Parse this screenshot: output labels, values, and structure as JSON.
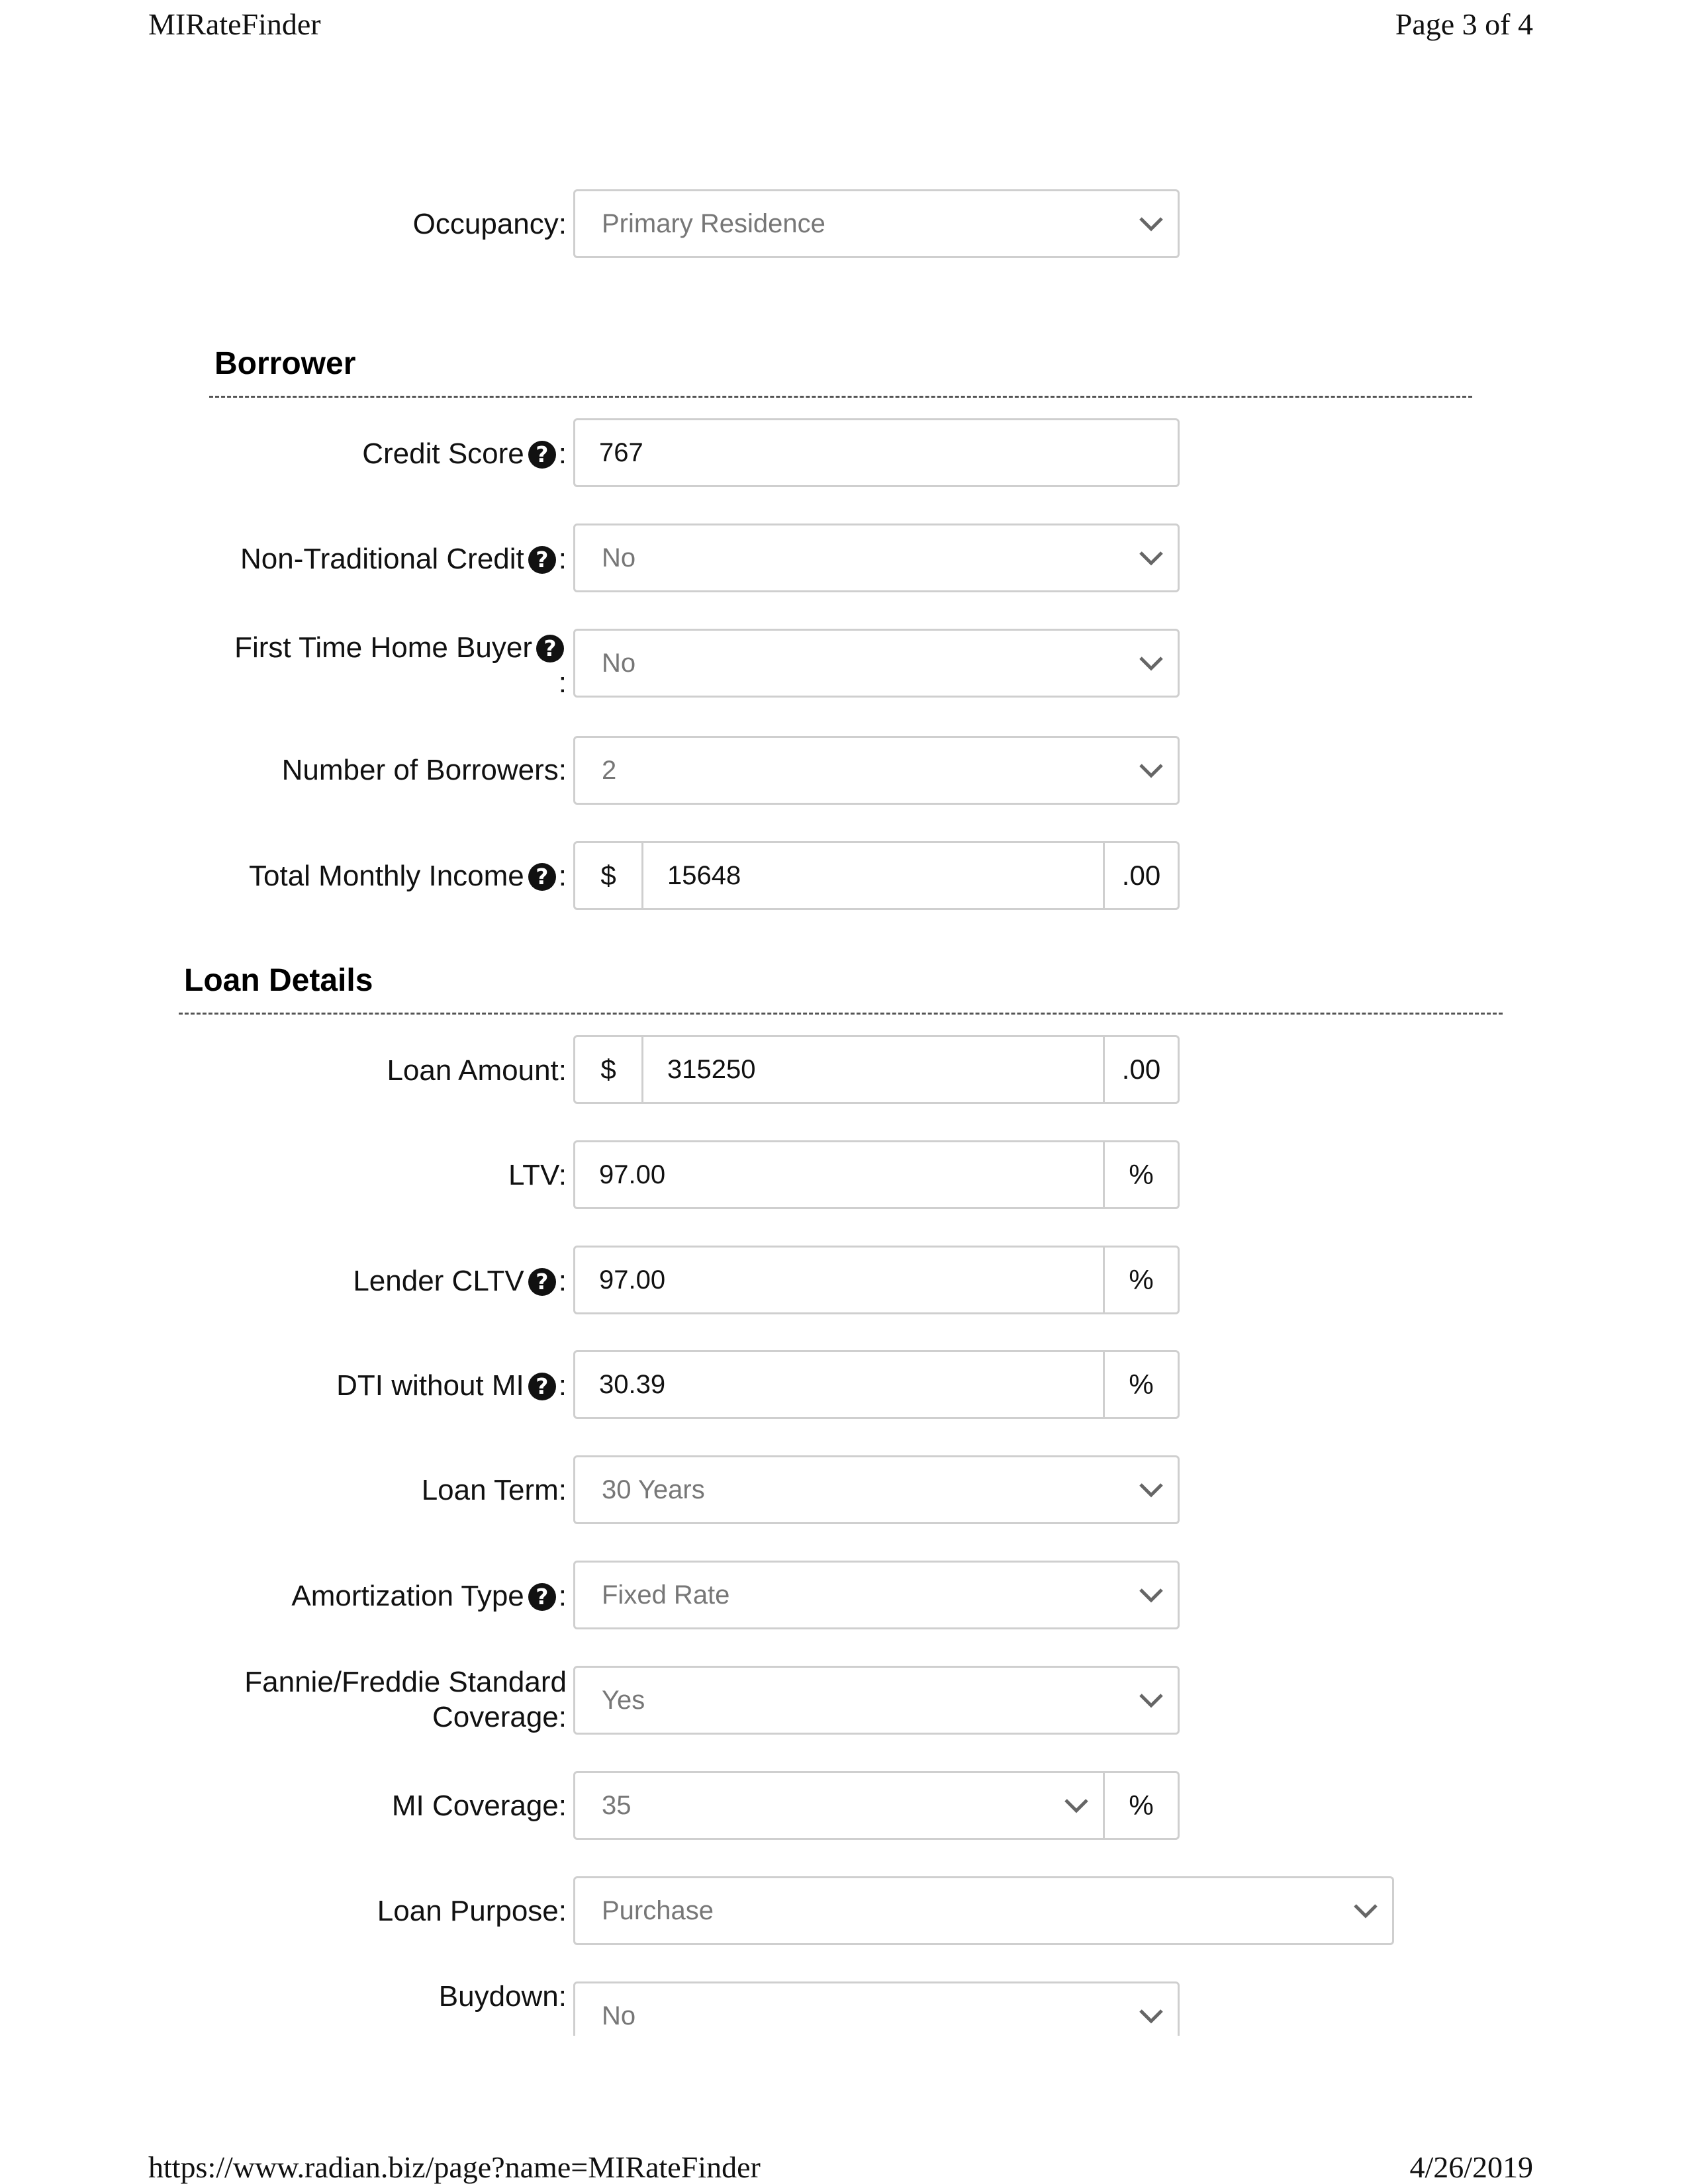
{
  "header": {
    "app_name": "MIRateFinder",
    "page_indicator": "Page 3 of 4"
  },
  "footer": {
    "url": "https://www.radian.biz/page?name=MIRateFinder",
    "date": "4/26/2019"
  },
  "help_glyph": "?",
  "colon": ":",
  "occupancy": {
    "label": "Occupancy:",
    "value": "Primary Residence"
  },
  "borrower": {
    "heading": "Borrower",
    "credit_score": {
      "label": "Credit Score",
      "value": "767"
    },
    "non_traditional_credit": {
      "label": "Non-Traditional Credit",
      "value": "No"
    },
    "first_time_home_buyer": {
      "label": "First Time Home Buyer",
      "value": "No"
    },
    "number_of_borrowers": {
      "label": "Number of Borrowers:",
      "value": "2"
    },
    "total_monthly_income": {
      "label": "Total Monthly Income",
      "prefix": "$",
      "value": "15648",
      "suffix": ".00"
    }
  },
  "loan_details": {
    "heading": "Loan Details",
    "loan_amount": {
      "label": "Loan Amount:",
      "prefix": "$",
      "value": "315250",
      "suffix": ".00"
    },
    "ltv": {
      "label": "LTV:",
      "value": "97.00",
      "unit": "%"
    },
    "lender_cltv": {
      "label": "Lender CLTV",
      "value": "97.00",
      "unit": "%"
    },
    "dti_without_mi": {
      "label": "DTI without MI",
      "value": "30.39",
      "unit": "%"
    },
    "loan_term": {
      "label": "Loan Term:",
      "value": "30 Years"
    },
    "amortization_type": {
      "label": "Amortization Type",
      "value": "Fixed Rate"
    },
    "standard_coverage": {
      "label_line1": "Fannie/Freddie Standard",
      "label_line2": "Coverage:",
      "value": "Yes"
    },
    "mi_coverage": {
      "label": "MI Coverage:",
      "value": "35",
      "unit": "%"
    },
    "loan_purpose": {
      "label": "Loan Purpose:",
      "value": "Purchase"
    },
    "buydown": {
      "label": "Buydown:",
      "value": "No"
    }
  }
}
